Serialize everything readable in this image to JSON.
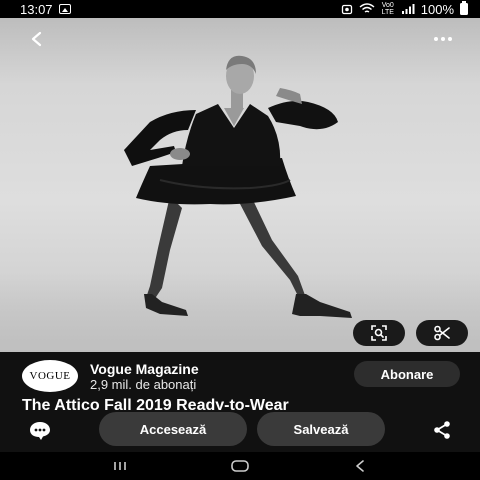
{
  "status_bar": {
    "time": "13:07",
    "network_label": "Vo0 LTE",
    "battery_text": "100%"
  },
  "image": {
    "description_icon": "fashion-photo"
  },
  "profile": {
    "avatar_text": "VOGUE",
    "name": "Vogue Magazine",
    "followers": "2,9 mil. de abonați",
    "subscribe_label": "Abonare"
  },
  "pin": {
    "title": "The Attico Fall 2019 Ready-to-Wear"
  },
  "actions": {
    "visit_label": "Accesează",
    "save_label": "Salvează"
  },
  "icons": {
    "back": "back-arrow-icon",
    "more": "more-dots-icon",
    "visual_search": "visual-search-icon",
    "crop": "scissors-icon",
    "comment": "comment-icon",
    "share": "share-icon"
  },
  "colors": {
    "background": "#111111",
    "button": "#3a3a3a"
  }
}
